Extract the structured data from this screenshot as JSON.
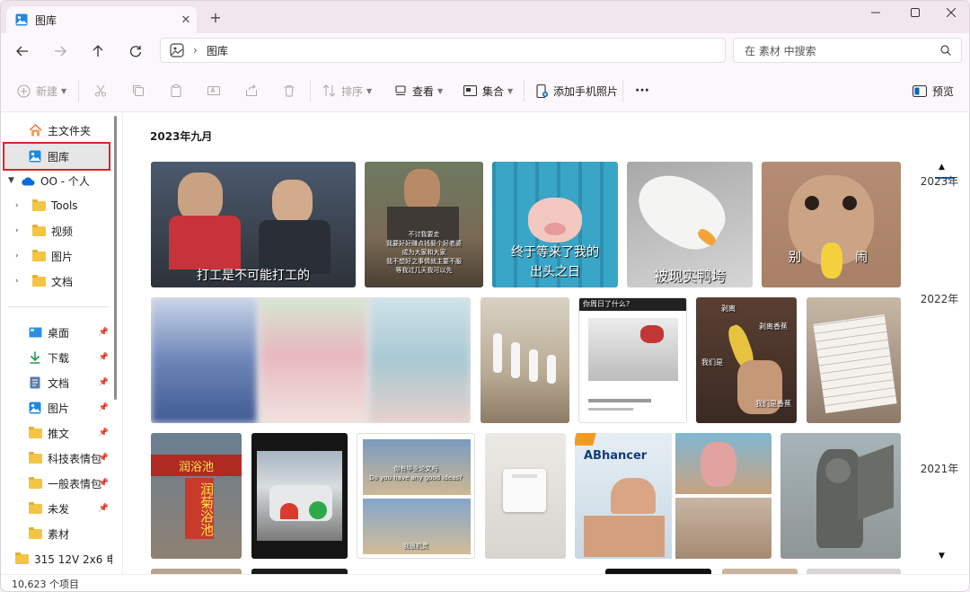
{
  "tab": {
    "title": "图库",
    "close": "✕",
    "new": "+"
  },
  "window_controls": {
    "minimize": "—",
    "maximize": "☐",
    "close": "✕"
  },
  "address": {
    "crumb": "图库"
  },
  "search": {
    "placeholder": "在 素材 中搜索"
  },
  "toolbar": {
    "new": "新建",
    "sort": "排序",
    "view": "查看",
    "collection": "集合",
    "add_phone_photos": "添加手机照片",
    "more": "···",
    "preview": "预览"
  },
  "sidebar": {
    "home": "主文件夹",
    "gallery": "图库",
    "onedrive": "OO - 个人",
    "tree": [
      "Tools",
      "视频",
      "图片",
      "文档"
    ],
    "pinned": [
      "桌面",
      "下载",
      "文档",
      "图片",
      "推文",
      "科技表情包",
      "一般表情包",
      "未发",
      "素材",
      "315 12V 2x6 电"
    ]
  },
  "content": {
    "section_title": "2023年九月",
    "timeline": [
      "2023年",
      "2022年",
      "2021年"
    ],
    "captions": {
      "c1": "打工是不可能打工的",
      "c2_lines": [
        "不讨我要走",
        "我要好好赚点钱娶个好老婆",
        "成为大家和大家",
        "我不想好之事情就主要不服",
        "等我过几天我可以先"
      ],
      "c3_lines": [
        "终于等来了我的",
        "出头之日"
      ],
      "c4": "被现实鸭垮",
      "c5a": "别",
      "c5b": "闹",
      "c9": "你周日了什么?",
      "c10_lines": [
        "剥离",
        "剥离香蕉",
        "我们是",
        "我们是香蕉"
      ],
      "c12_lines": [
        "润浴池",
        "润菊浴池"
      ],
      "c14_lines": [
        "你有毕业论文吗",
        "Do you have any good ideas?",
        "我很机灵"
      ],
      "c16": "ABhancer"
    }
  },
  "status": {
    "count": "10,623 个项目"
  },
  "colors": {
    "accent": "#0067c0",
    "selection_outline": "#e0212b",
    "folder": "#f3c543"
  }
}
